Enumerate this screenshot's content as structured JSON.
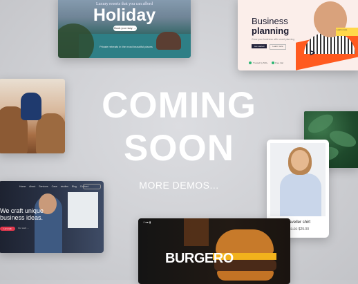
{
  "headline": {
    "line1": "COMING",
    "line2": "SOON",
    "more": "MORE DEMOS..."
  },
  "holiday": {
    "tagline": "Luxury resorts that you can afford",
    "title": "Holiday",
    "button": "Book your stay →",
    "caption": "Private retreats in the most beautiful places"
  },
  "business": {
    "title_line1": "Business",
    "title_line2": "planning",
    "subtitle": "Grow your business with smart planning",
    "btn_primary": "Get started",
    "btn_secondary": "Learn more",
    "feature1": "Trusted by 500+",
    "feature2": "Free trial"
  },
  "agency": {
    "nav": "Home About Services Case studies Blog Contact",
    "headline_line1": "We craft unique",
    "headline_line2": "business ideas.",
    "cta_primary": "Let's talk",
    "cta_secondary": "Our work →"
  },
  "product": {
    "name": "Traveller shirt",
    "old_price": "$39.00",
    "price": "$29.00"
  },
  "burgero": {
    "logo": "J ●● ▮",
    "title": "BURGERO"
  },
  "colors": {
    "background": "#cfd0d4",
    "accent_orange": "#ff5a1f",
    "accent_red": "#e2384d"
  }
}
